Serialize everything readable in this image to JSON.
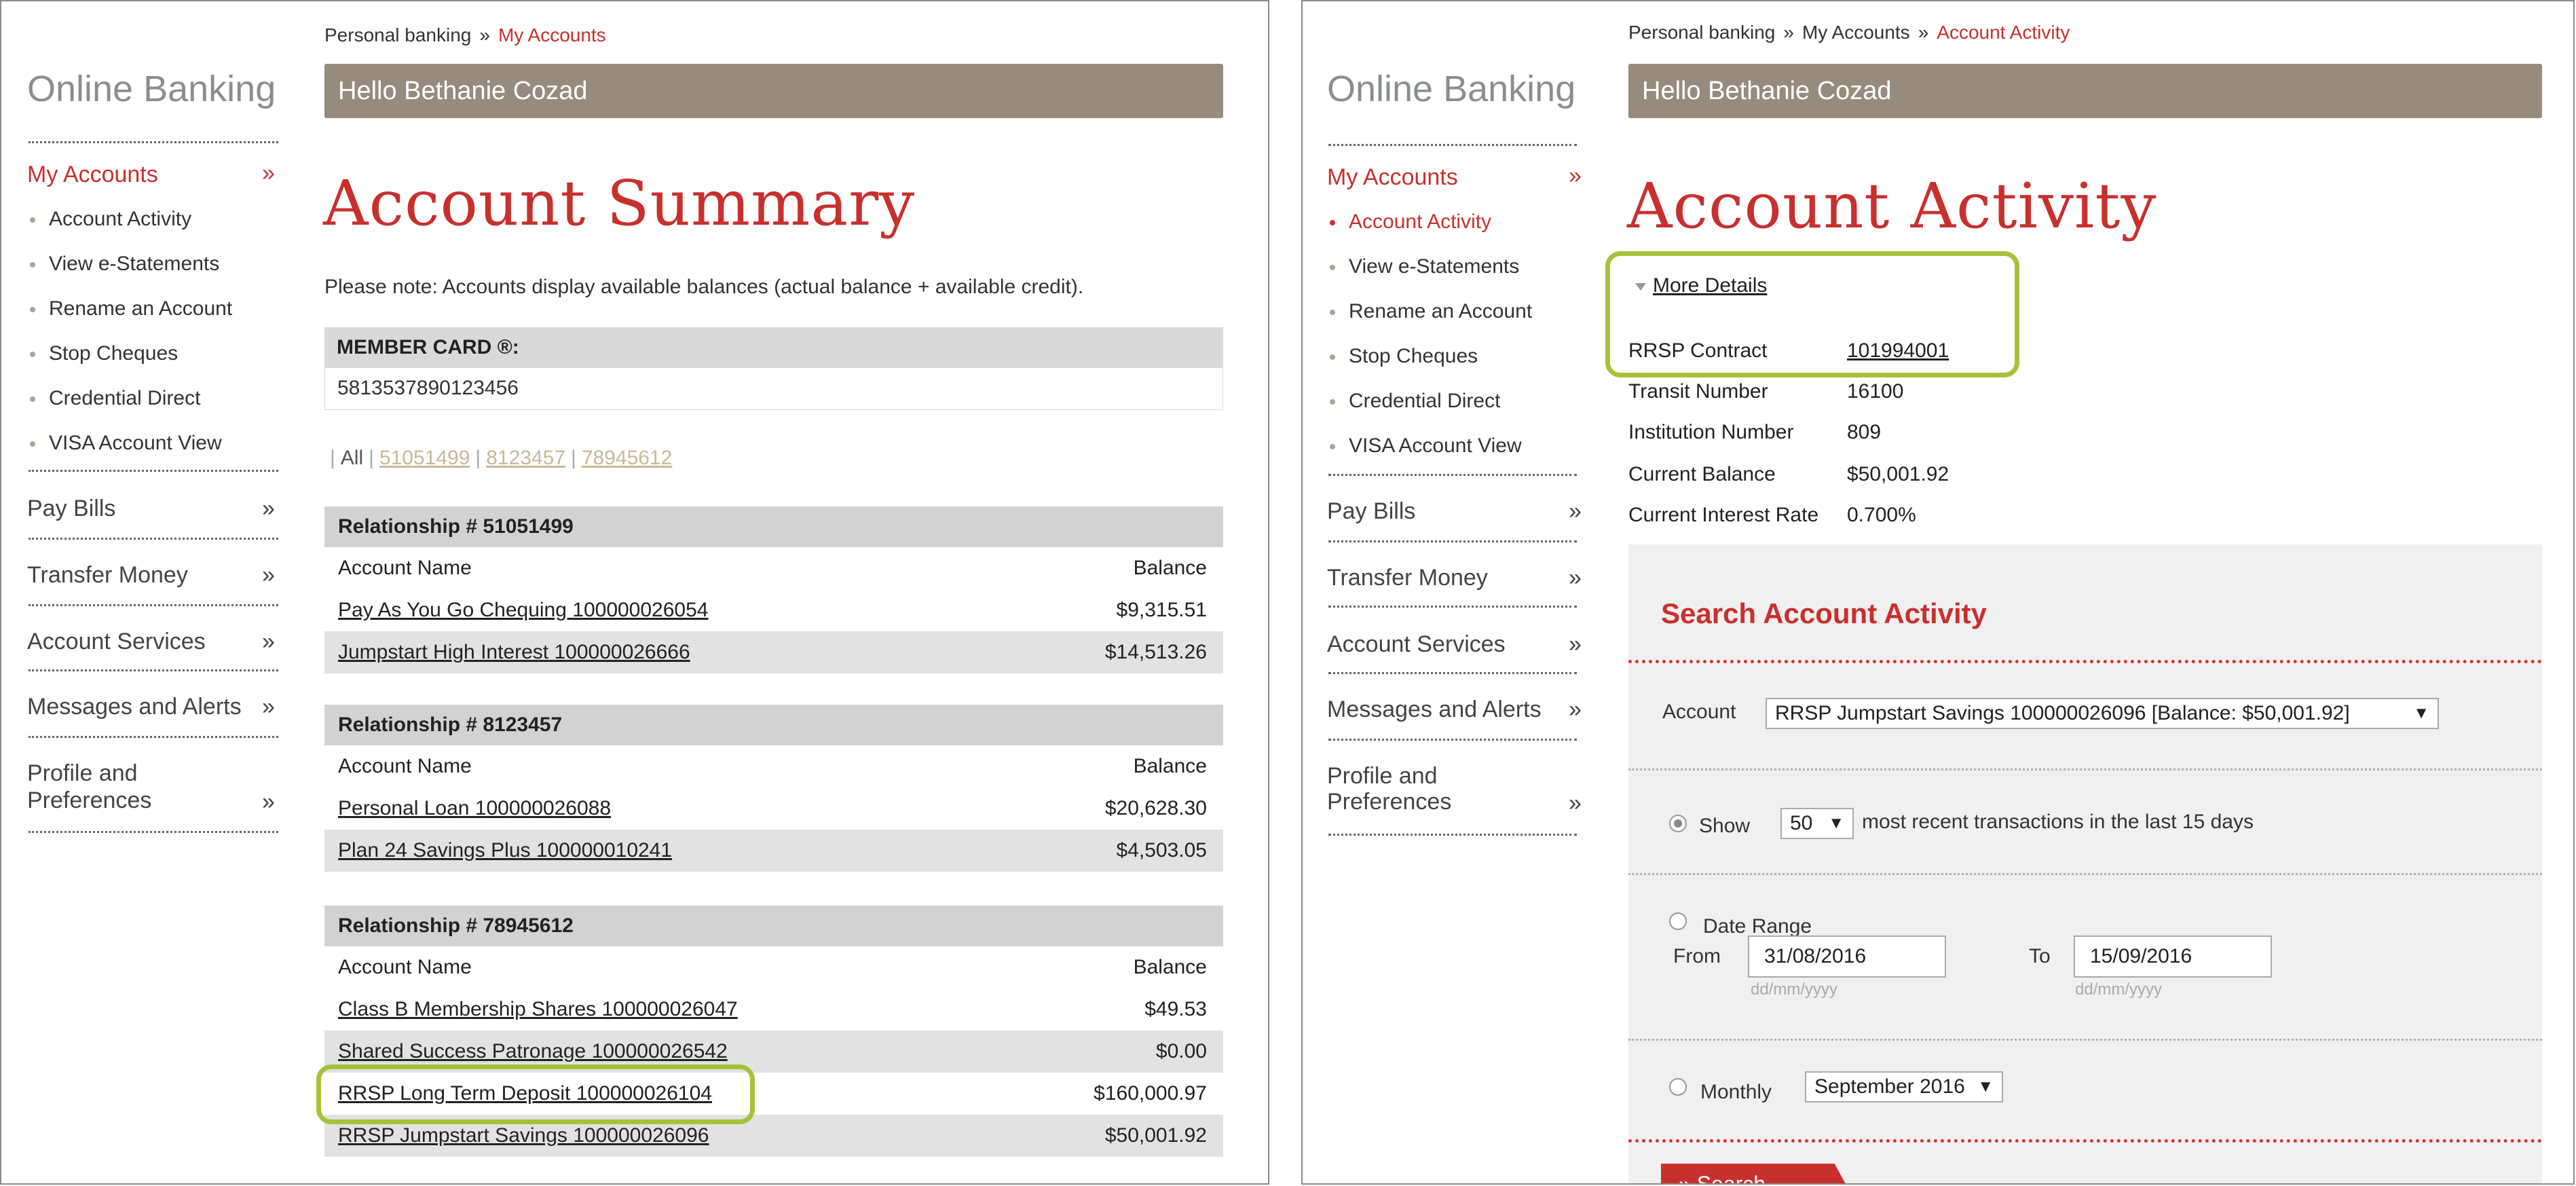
{
  "sidebar": {
    "title": "Online Banking",
    "my_accounts": "My Accounts",
    "chevron": "»",
    "sub_items": [
      "Account Activity",
      "View e-Statements",
      "Rename an Account",
      "Stop Cheques",
      "Credential Direct",
      "VISA Account View"
    ],
    "sections": [
      "Pay Bills",
      "Transfer Money",
      "Account Services",
      "Messages and Alerts"
    ],
    "profile_line1": "Profile and",
    "profile_line2": "Preferences"
  },
  "left": {
    "breadcrumb": [
      "Personal banking",
      "My Accounts"
    ],
    "crumb_sep": "»",
    "hello": "Hello Bethanie Cozad",
    "title": "Account Summary",
    "note": "Please note: Accounts display available balances (actual balance + available credit).",
    "member_card_label": "MEMBER CARD ®:",
    "member_card_number": "5813537890123456",
    "filter": {
      "all": "All",
      "bar": "|",
      "links": [
        "51051499",
        "8123457",
        "78945612"
      ]
    },
    "col_name": "Account Name",
    "col_balance": "Balance",
    "relationships": [
      {
        "title": "Relationship # 51051499",
        "accounts": [
          {
            "name": "Pay As You Go Chequing 100000026054",
            "balance": "$9,315.51"
          },
          {
            "name": "Jumpstart High Interest 100000026666",
            "balance": "$14,513.26"
          }
        ]
      },
      {
        "title": "Relationship # 8123457",
        "accounts": [
          {
            "name": "Personal Loan 100000026088",
            "balance": "$20,628.30"
          },
          {
            "name": "Plan 24 Savings Plus 100000010241",
            "balance": "$4,503.05"
          }
        ]
      },
      {
        "title": "Relationship # 78945612",
        "accounts": [
          {
            "name": "Class B Membership Shares 100000026047",
            "balance": "$49.53"
          },
          {
            "name": "Shared Success Patronage 100000026542",
            "balance": "$0.00"
          },
          {
            "name": "RRSP Long Term Deposit 100000026104",
            "balance": "$160,000.97"
          },
          {
            "name": "RRSP Jumpstart Savings 100000026096",
            "balance": "$50,001.92"
          }
        ]
      }
    ]
  },
  "right": {
    "breadcrumb": [
      "Personal banking",
      "My Accounts",
      "Account Activity"
    ],
    "hello": "Hello Bethanie Cozad",
    "title": "Account Activity",
    "more_details": "More Details",
    "details": [
      {
        "label": "RRSP Contract",
        "value": "101994001"
      },
      {
        "label": "Transit Number",
        "value": "16100"
      },
      {
        "label": "Institution Number",
        "value": "809"
      },
      {
        "label": "Current Balance",
        "value": "$50,001.92"
      },
      {
        "label": "Current Interest Rate",
        "value": "0.700%"
      }
    ],
    "search": {
      "title": "Search Account Activity",
      "account_label": "Account",
      "account_value": "RRSP Jumpstart Savings 100000026096 [Balance: $50,001.92]",
      "show_label": "Show",
      "show_value": "50",
      "show_suffix": "most recent transactions in the last 15 days",
      "date_range_label": "Date Range",
      "from_label": "From",
      "from_value": "31/08/2016",
      "to_label": "To",
      "to_value": "15/09/2016",
      "date_hint": "dd/mm/yyyy",
      "monthly_label": "Monthly",
      "monthly_value": "September 2016",
      "search_button": "» Search",
      "dropdown_arrow": "▼"
    }
  },
  "colors": {
    "accent_red": "#c8302e",
    "header_bar": "#968b7c",
    "highlight_green": "#a5c23a"
  }
}
